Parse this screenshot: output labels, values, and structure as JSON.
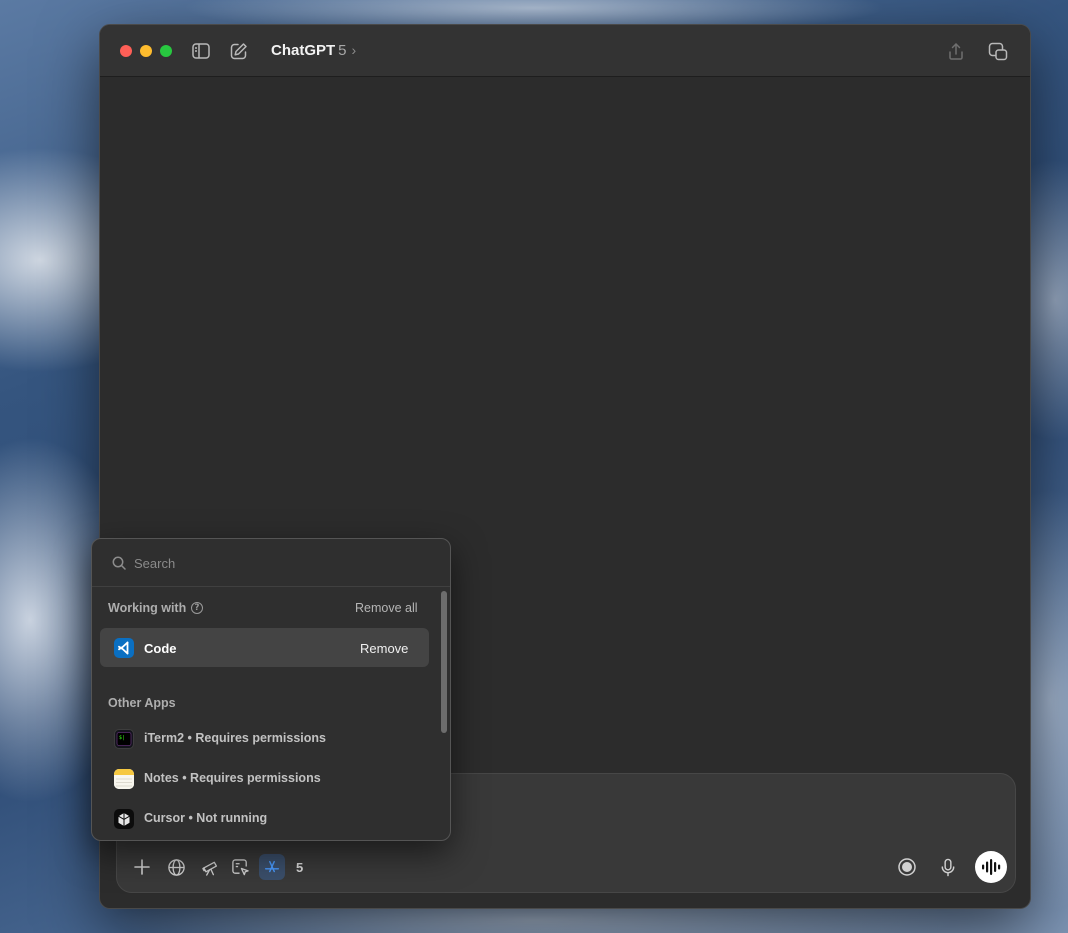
{
  "window": {
    "title": "ChatGPT",
    "model_version": "5",
    "icons": {
      "sidebar": "sidebar-toggle-icon",
      "new_chat": "compose-icon",
      "share": "share-icon",
      "window_mode": "window-mode-icon"
    }
  },
  "composer": {
    "tools": [
      "plus-icon",
      "globe-icon",
      "telescope-icon",
      "canvas-icon",
      "apps-icon"
    ],
    "app_count": "5",
    "right_tools": [
      "record-icon",
      "microphone-icon",
      "voice-mode-icon"
    ]
  },
  "popover": {
    "search": {
      "placeholder": "Search",
      "value": ""
    },
    "working_with": {
      "label": "Working with",
      "remove_all": "Remove all",
      "apps": [
        {
          "name": "Code",
          "action": "Remove",
          "icon": "vscode-icon"
        }
      ]
    },
    "other_apps": {
      "label": "Other Apps",
      "apps": [
        {
          "label": "iTerm2 • Requires permissions",
          "icon": "iterm2-icon"
        },
        {
          "label": "Notes • Requires permissions",
          "icon": "notes-icon"
        },
        {
          "label": "Cursor • Not running",
          "icon": "cursor-app-icon"
        }
      ]
    }
  },
  "colors": {
    "window_bg": "#2c2c2c",
    "titlebar_bg": "#333333",
    "accent_blue": "#3b82f6",
    "traffic_red": "#fe5f57",
    "traffic_yellow": "#febc2e",
    "traffic_green": "#28c840"
  }
}
